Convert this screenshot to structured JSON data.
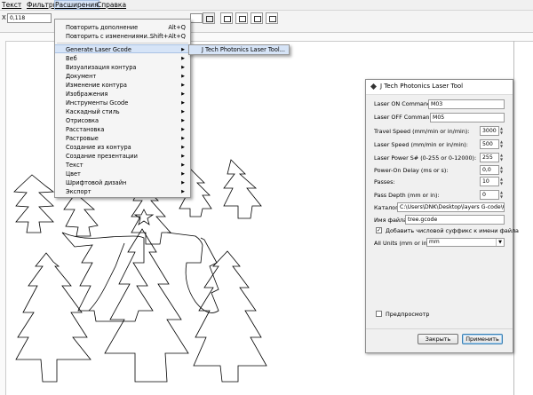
{
  "menubar": {
    "items": [
      "Текст",
      "Фильтры",
      "Расширения",
      "Справка"
    ]
  },
  "toolbar": {
    "field_value": "0,118"
  },
  "extensions_menu": {
    "items": [
      {
        "label": "Повторить дополнение",
        "shortcut": "Alt+Q"
      },
      {
        "label": "Повторить с изменениями...",
        "shortcut": "Shift+Alt+Q"
      },
      {
        "label": "Generate Laser Gcode",
        "submenu": true,
        "highlighted": true
      },
      {
        "label": "Веб",
        "submenu": true
      },
      {
        "label": "Визуализация контура",
        "submenu": true
      },
      {
        "label": "Документ",
        "submenu": true
      },
      {
        "label": "Изменение контура",
        "submenu": true
      },
      {
        "label": "Изображения",
        "submenu": true
      },
      {
        "label": "Инструменты Gcode",
        "submenu": true
      },
      {
        "label": "Каскадный стиль",
        "submenu": true
      },
      {
        "label": "Отрисовка",
        "submenu": true
      },
      {
        "label": "Расстановка",
        "submenu": true
      },
      {
        "label": "Растровые",
        "submenu": true
      },
      {
        "label": "Создание из контура",
        "submenu": true
      },
      {
        "label": "Создание презентации",
        "submenu": true
      },
      {
        "label": "Текст",
        "submenu": true
      },
      {
        "label": "Цвет",
        "submenu": true
      },
      {
        "label": "Шрифтовой дизайн",
        "submenu": true
      },
      {
        "label": "Экспорт",
        "submenu": true
      }
    ],
    "submenu_item": "J Tech Photonics Laser Tool..."
  },
  "dialog": {
    "title": "J Tech Photonics Laser Tool",
    "laser_on_label": "Laser ON Command:",
    "laser_on_value": "M03",
    "laser_off_label": "Laser OFF Command:",
    "laser_off_value": "M05",
    "travel_speed_label": "Travel Speed (mm/min or in/min):",
    "travel_speed_value": "3000",
    "laser_speed_label": "Laser Speed (mm/min or in/min):",
    "laser_speed_value": "500",
    "laser_power_label": "Laser Power S# (0-255 or 0-12000):",
    "laser_power_value": "255",
    "power_on_delay_label": "Power-On Delay (ms or s):",
    "power_on_delay_value": "0,0",
    "passes_label": "Passes:",
    "passes_value": "10",
    "pass_depth_label": "Pass Depth (mm or in):",
    "pass_depth_value": "0",
    "directory_label": "Каталог:",
    "directory_value": "C:\\Users\\DNK\\Desktop\\layers G-code\\G-c",
    "filename_label": "Имя файла:",
    "filename_value": "tree.gcode",
    "suffix_label": "Добавить числовой суффикс к имени файла",
    "suffix_checked": true,
    "units_label": "All Units (mm or in):",
    "units_value": "mm",
    "preview_label": "Предпросмотр",
    "preview_checked": false,
    "close_button": "Закрыть",
    "apply_button": "Применить"
  }
}
